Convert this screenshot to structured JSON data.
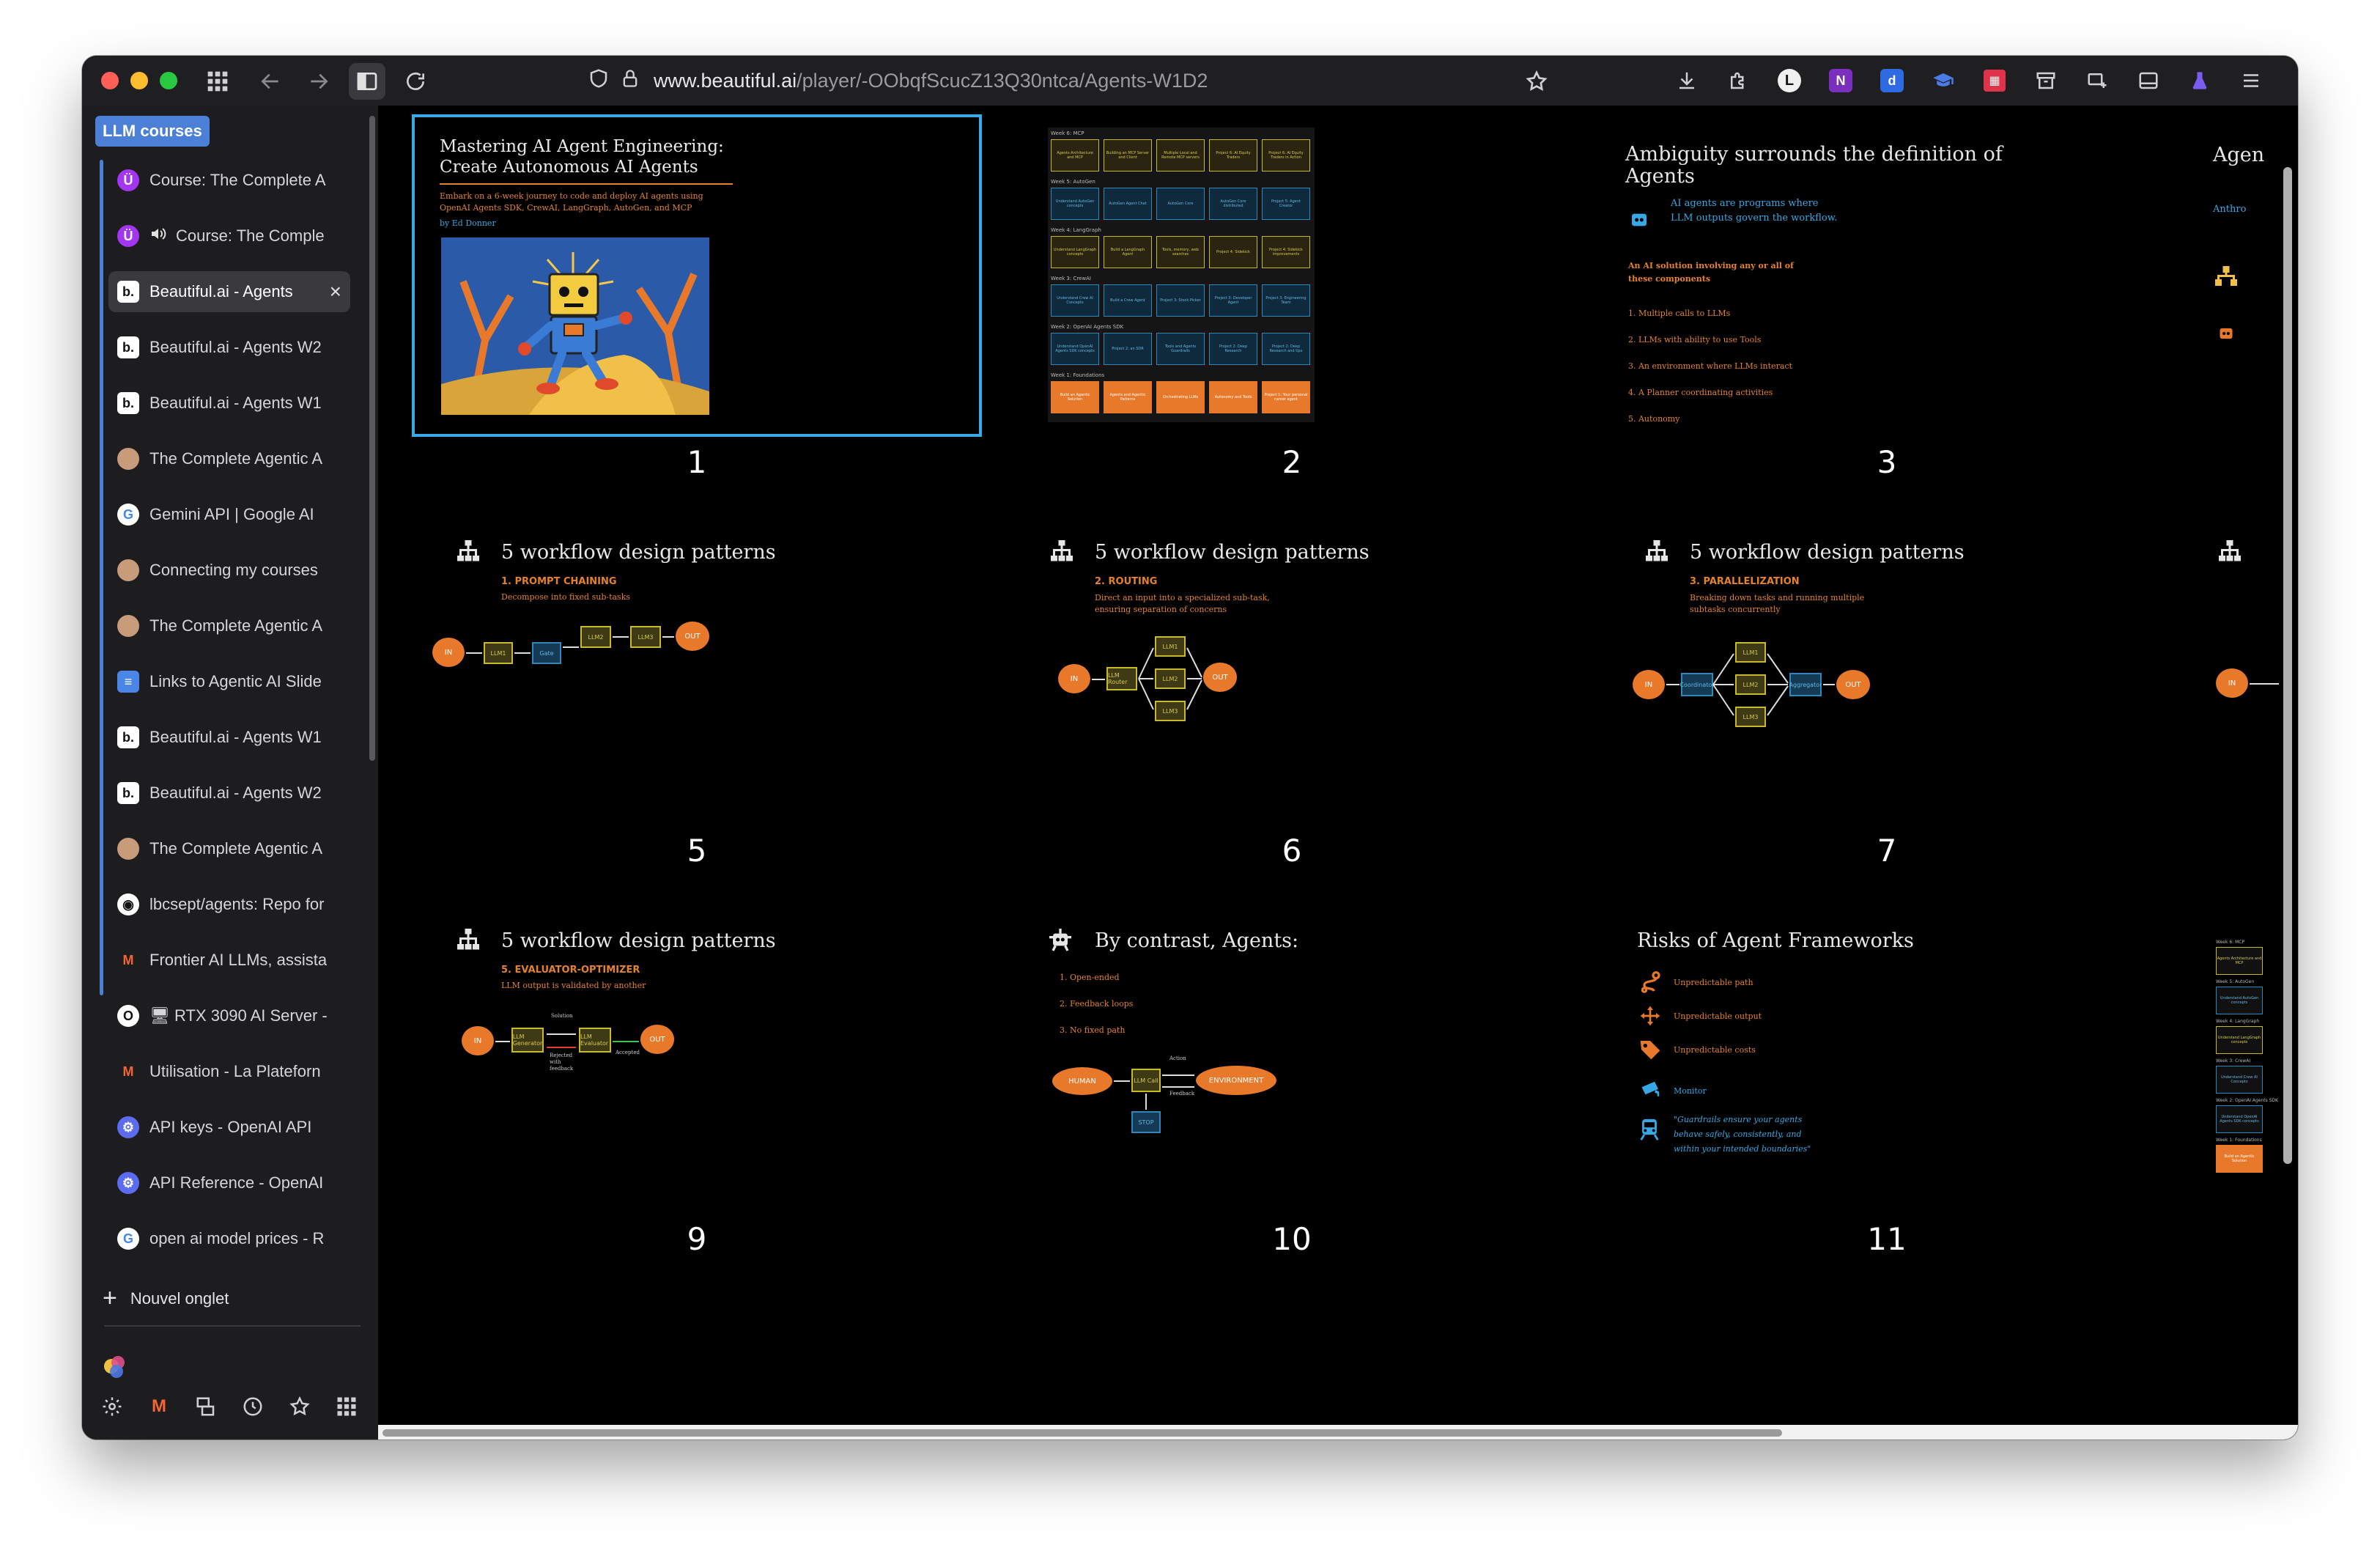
{
  "browser": {
    "url_host": "www.beautiful.ai",
    "url_path": "/player/-OObqfScucZ13Q30ntca/Agents-W1D2"
  },
  "sidebar": {
    "group_label": "LLM courses",
    "tabs": [
      {
        "title": "Course: The Complete A",
        "icon": "udemy-icon",
        "color": "#a435f0",
        "glyph": "Ü"
      },
      {
        "title": "Course: The Comple",
        "icon": "udemy-icon",
        "color": "#a435f0",
        "glyph": "Ü",
        "audio": true
      },
      {
        "title": "Beautiful.ai - Agents",
        "icon": "beautiful-ai-icon",
        "color": "#ffffff",
        "glyph": "b.",
        "active": true
      },
      {
        "title": "Beautiful.ai - Agents W2",
        "icon": "beautiful-ai-icon",
        "color": "#ffffff",
        "glyph": "b."
      },
      {
        "title": "Beautiful.ai - Agents W1",
        "icon": "beautiful-ai-icon",
        "color": "#ffffff",
        "glyph": "b."
      },
      {
        "title": "The Complete Agentic A",
        "icon": "avatar-icon",
        "color": "#c89b7b",
        "glyph": ""
      },
      {
        "title": "Gemini API | Google AI",
        "icon": "google-icon",
        "color": "#ffffff",
        "glyph": "G"
      },
      {
        "title": "Connecting my courses",
        "icon": "avatar-icon",
        "color": "#c89b7b",
        "glyph": ""
      },
      {
        "title": "The Complete Agentic A",
        "icon": "avatar-icon",
        "color": "#c89b7b",
        "glyph": ""
      },
      {
        "title": "Links to Agentic AI Slide",
        "icon": "google-docs-icon",
        "color": "#4a86e8",
        "glyph": "≡"
      },
      {
        "title": "Beautiful.ai - Agents W1",
        "icon": "beautiful-ai-icon",
        "color": "#ffffff",
        "glyph": "b."
      },
      {
        "title": "Beautiful.ai - Agents W2",
        "icon": "beautiful-ai-icon",
        "color": "#ffffff",
        "glyph": "b."
      },
      {
        "title": "The Complete Agentic A",
        "icon": "avatar-icon",
        "color": "#c89b7b",
        "glyph": ""
      },
      {
        "title": "lbcsept/agents: Repo for",
        "icon": "github-icon",
        "color": "#ffffff",
        "glyph": "◉"
      },
      {
        "title": "Frontier AI LLMs, assista",
        "icon": "mistral-icon",
        "color": "#f4662b",
        "glyph": "M"
      },
      {
        "title": "🖥 RTX 3090 AI Server -",
        "icon": "ollama-icon",
        "color": "#ffffff",
        "glyph": "O"
      },
      {
        "title": "Utilisation - La Plateforn",
        "icon": "mistral-icon",
        "color": "#f4662b",
        "glyph": "M"
      },
      {
        "title": "API keys - OpenAI API",
        "icon": "openai-icon",
        "color": "#5b6cf0",
        "glyph": "⚙"
      },
      {
        "title": "API Reference - OpenAI",
        "icon": "openai-icon",
        "color": "#5b6cf0",
        "glyph": "⚙"
      },
      {
        "title": "open ai model prices - R",
        "icon": "google-icon",
        "color": "#ffffff",
        "glyph": "G"
      }
    ],
    "new_tab_label": "Nouvel onglet"
  },
  "slides": {
    "s1": {
      "number": "1",
      "title_line1": "Mastering AI Agent Engineering:",
      "title_line2": "Create Autonomous AI Agents",
      "sub1": "Embark on a 6-week journey to code and deploy AI agents using",
      "sub2": "OpenAI Agents SDK, CrewAI, LangGraph, AutoGen, and MCP",
      "author": "by Ed Donner"
    },
    "s2": {
      "number": "2",
      "weeks": [
        {
          "label": "Week 6: MCP",
          "cells": [
            "Agents Architecture and MCP",
            "Building an MCP Server and Client",
            "Multiple Local and Remote MCP servers",
            "Project 6: AI Equity Traders",
            "Project 6: AI Equity Traders in Action"
          ]
        },
        {
          "label": "Week 5: AutoGen",
          "cells": [
            "Understand AutoGen concepts",
            "AutoGen Agent Chat",
            "AutoGen Core",
            "AutoGen Core distributed",
            "Project 5: Agent Creator"
          ]
        },
        {
          "label": "Week 4: LangGraph",
          "cells": [
            "Understand LangGraph concepts",
            "Build a LangGraph Agent",
            "Tools, memory, web searches",
            "Project 4: Sidekick",
            "Project 4: Sidekick improvements"
          ]
        },
        {
          "label": "Week 3: CrewAI",
          "cells": [
            "Understand Crew AI Concepts",
            "Build a Crew Agent",
            "Project 3: Stock Picker",
            "Project 3: Developer Agent",
            "Project 3: Engineering Team"
          ]
        },
        {
          "label": "Week 2: OpenAI Agents SDK",
          "cells": [
            "Understand OpenAI Agents SDK concepts",
            "Project 2: an SDR",
            "Tools and Agents Guardrails",
            "Project 2: Deep Research",
            "Project 2: Deep Research and tips"
          ]
        },
        {
          "label": "Week 1: Foundations",
          "cells": [
            "Build an Agentic Solution",
            "Agents and Agentic Patterns",
            "Orchestrating LLMs",
            "Autonomy and Tools",
            "Project 1: Your personal career agent"
          ]
        }
      ]
    },
    "s3": {
      "number": "3",
      "title": "Ambiguity surrounds the definition of Agents",
      "callout_line1": "AI agents are programs where",
      "callout_line2": "LLM outputs govern the workflow.",
      "list_head1": "An AI solution involving any or all of",
      "list_head2": "these components",
      "items": [
        "1. Multiple calls to LLMs",
        "2. LLMs with ability to use Tools",
        "3. An environment where LLMs interact",
        "4. A Planner coordinating activities",
        "5. Autonomy"
      ]
    },
    "s4": {
      "title": "Agen",
      "sub": "Anthro"
    },
    "s5": {
      "number": "5",
      "title": "5 workflow design patterns",
      "pattern": "1. PROMPT CHAINING",
      "desc": "Decompose into fixed sub-tasks"
    },
    "s6": {
      "number": "6",
      "title": "5 workflow design patterns",
      "pattern": "2. ROUTING",
      "desc1": "Direct an input into a specialized sub-task,",
      "desc2": "ensuring separation of concerns"
    },
    "s7": {
      "number": "7",
      "title": "5 workflow design patterns",
      "pattern": "3. PARALLELIZATION",
      "desc1": "Breaking down tasks and running multiple",
      "desc2": "subtasks concurrently"
    },
    "s9": {
      "number": "9",
      "title": "5 workflow design patterns",
      "pattern": "5. EVALUATOR-OPTIMIZER",
      "desc": "LLM output is validated by another"
    },
    "s10": {
      "number": "10",
      "title": "By contrast, Agents:",
      "items": [
        "1. Open-ended",
        "2. Feedback loops",
        "3. No fixed path"
      ]
    },
    "s11": {
      "number": "11",
      "title": "Risks of Agent Frameworks",
      "risks": [
        "Unpredictable path",
        "Unpredictable output",
        "Unpredictable costs"
      ],
      "monitor": "Monitor",
      "quote1": "\"Guardrails ensure your agents",
      "quote2": "behave safely, consistently, and",
      "quote3": "within your intended boundaries\""
    },
    "labels": {
      "in": "IN",
      "out": "OUT",
      "llm1": "LLM1",
      "llm2": "LLM2",
      "llm3": "LLM3",
      "gate": "Gate",
      "router": "LLM Router",
      "coord": "Coordinator",
      "aggr": "Aggregator",
      "gen": "LLM Generator",
      "eval": "LLM Evaluator",
      "solution": "Solution",
      "rejected": "Rejected with feedback",
      "accepted": "Accepted",
      "human": "HUMAN",
      "env": "ENVIRONMENT",
      "llmcall": "LLM Call",
      "stop": "STOP",
      "action": "Action",
      "feedback": "Feedback"
    }
  },
  "colors": {
    "accent": "#e8792a",
    "selection": "#38a8e6",
    "group": "#4c7fd6"
  }
}
